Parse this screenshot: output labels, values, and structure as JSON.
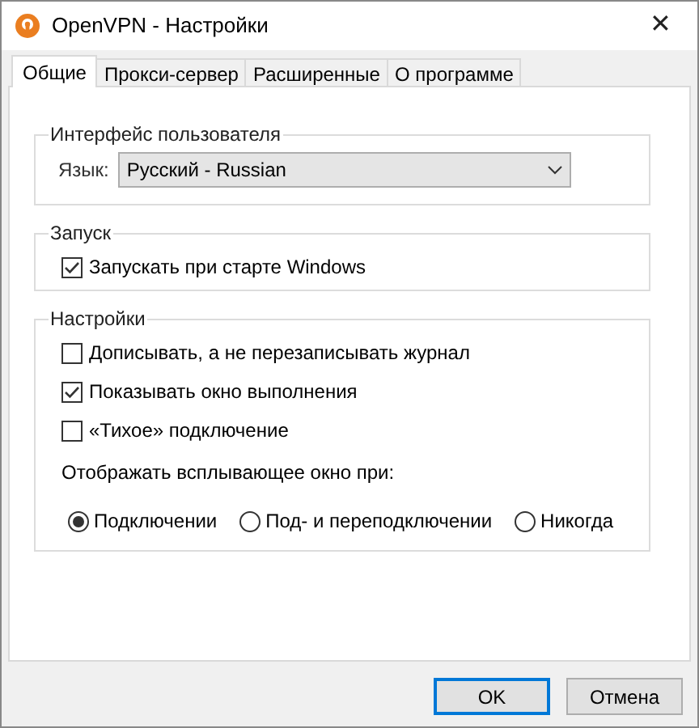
{
  "window": {
    "title": "OpenVPN - Настройки",
    "close": "✕"
  },
  "tabs": [
    {
      "label": "Общие",
      "selected": true
    },
    {
      "label": "Прокси-сервер",
      "selected": false
    },
    {
      "label": "Расширенные",
      "selected": false
    },
    {
      "label": "О программе",
      "selected": false
    }
  ],
  "groups": [
    {
      "title": "Интерфейс пользователя",
      "items": [
        {
          "kind": "dropdown",
          "label": "Язык:",
          "value": "Русский - Russian"
        }
      ]
    },
    {
      "title": "Запуск",
      "items": [
        {
          "kind": "checkbox",
          "label": "Запускать при старте Windows",
          "checked": true
        }
      ]
    },
    {
      "title": "Настройки",
      "items": [
        {
          "kind": "checkbox",
          "label": "Дописывать, а не перезаписывать журнал",
          "checked": false
        },
        {
          "kind": "checkbox",
          "label": "Показывать окно выполнения",
          "checked": true
        },
        {
          "kind": "checkbox",
          "label": "«Тихое» подключение",
          "checked": false
        },
        {
          "kind": "text",
          "label": "Отображать всплывающее окно при:"
        },
        {
          "kind": "radios",
          "options": [
            {
              "label": "Подключении",
              "selected": true
            },
            {
              "label": "Под- и переподключении",
              "selected": false
            },
            {
              "label": "Никогда",
              "selected": false
            }
          ]
        }
      ]
    }
  ],
  "buttons": [
    {
      "label": "OK",
      "default": true
    },
    {
      "label": "Отмена",
      "default": false
    }
  ]
}
